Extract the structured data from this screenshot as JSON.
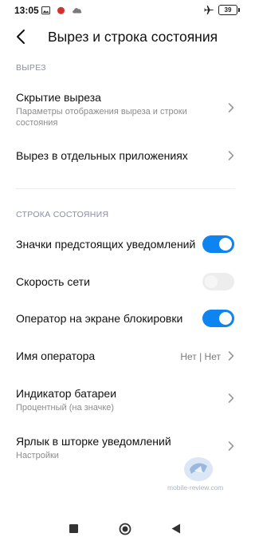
{
  "status_bar": {
    "time": "13:05",
    "battery": "39",
    "icons": [
      "image-icon",
      "tomato-icon",
      "cloud-icon",
      "airplane-icon",
      "battery-icon"
    ]
  },
  "header": {
    "title": "Вырез и строка состояния"
  },
  "section_notch": {
    "heading": "ВЫРЕЗ",
    "items": [
      {
        "title": "Скрытие выреза",
        "subtitle": "Параметры отображения выреза и строки состояния"
      },
      {
        "title": "Вырез в отдельных приложениях"
      }
    ]
  },
  "section_status": {
    "heading": "СТРОКА СОСТОЯНИЯ",
    "toggles": [
      {
        "label": "Значки предстоящих уведомлений",
        "on": true
      },
      {
        "label": "Скорость сети",
        "on": false
      },
      {
        "label": "Оператор на экране блокировки",
        "on": true
      }
    ],
    "operator_name": {
      "label": "Имя оператора",
      "value": "Нет | Нет"
    },
    "battery_indicator": {
      "title": "Индикатор батареи",
      "subtitle": "Процентный (на значке)"
    },
    "shortcut": {
      "title": "Ярлык в шторке уведомлений",
      "subtitle": "Настройки"
    }
  },
  "watermark": "mobile-review.com",
  "colors": {
    "accent": "#0d84f0",
    "section_heading": "#8a8fa8",
    "subtitle": "#8c8c8c"
  }
}
